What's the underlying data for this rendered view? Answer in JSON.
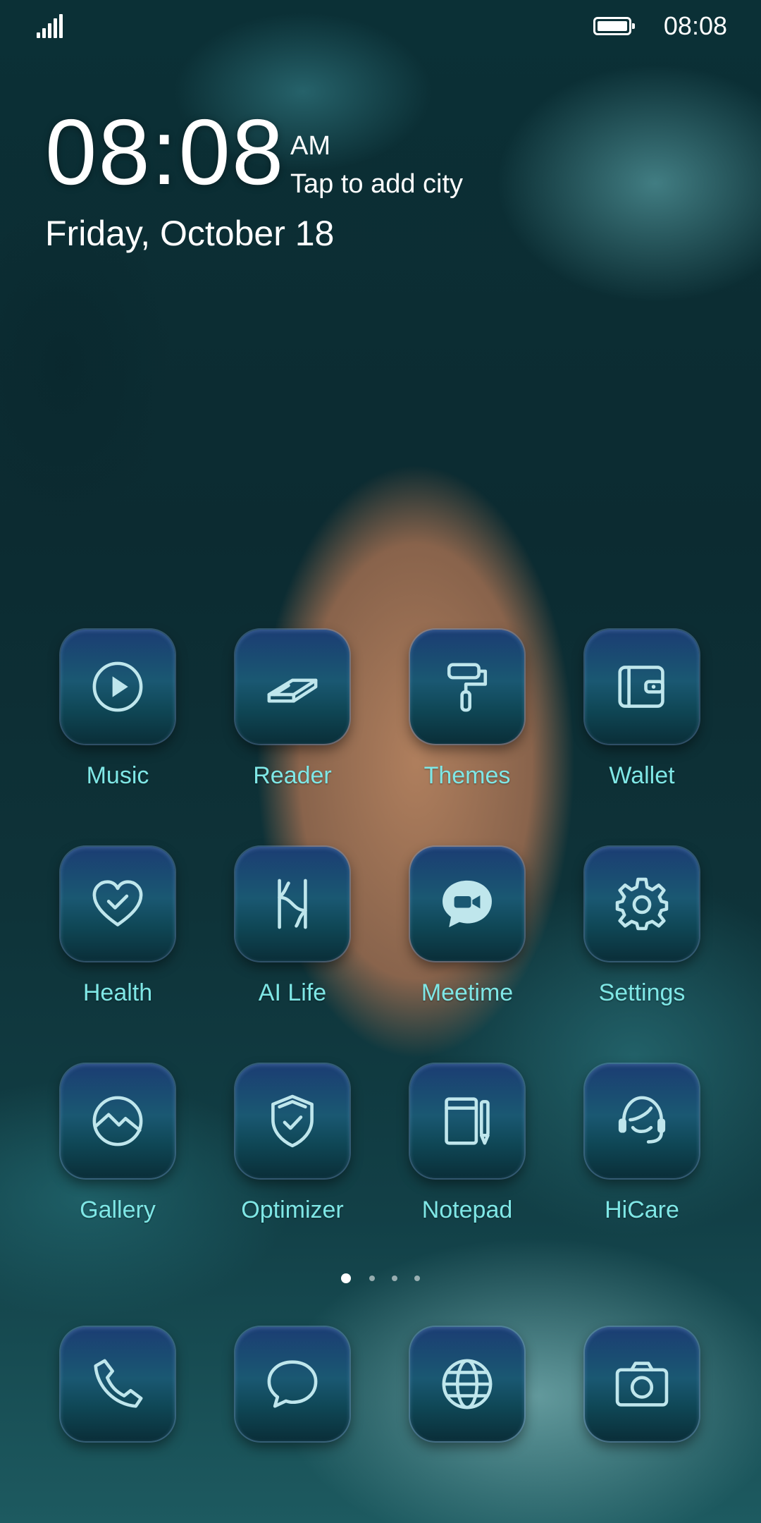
{
  "status_bar": {
    "time": "08:08"
  },
  "lock": {
    "clock": "08:08",
    "ampm": "AM",
    "city_prompt": "Tap to add city",
    "date": "Friday, October 18"
  },
  "apps": [
    {
      "label": "Music",
      "icon": "play-circle-icon"
    },
    {
      "label": "Reader",
      "icon": "book-icon"
    },
    {
      "label": "Themes",
      "icon": "paint-roller-icon"
    },
    {
      "label": "Wallet",
      "icon": "wallet-icon"
    },
    {
      "label": "Health",
      "icon": "heart-check-icon"
    },
    {
      "label": "AI Life",
      "icon": "ai-life-icon"
    },
    {
      "label": "Meetime",
      "icon": "video-chat-icon"
    },
    {
      "label": "Settings",
      "icon": "gear-icon"
    },
    {
      "label": "Gallery",
      "icon": "gallery-icon"
    },
    {
      "label": "Optimizer",
      "icon": "shield-check-icon"
    },
    {
      "label": "Notepad",
      "icon": "notepad-icon"
    },
    {
      "label": "HiCare",
      "icon": "headset-icon"
    }
  ],
  "pager": {
    "pages": 4,
    "current": 1
  },
  "dock": [
    {
      "icon": "phone-icon"
    },
    {
      "icon": "message-icon"
    },
    {
      "icon": "browser-icon"
    },
    {
      "icon": "camera-icon"
    }
  ],
  "colors": {
    "label": "#7fe7e6",
    "icon_stroke": "#bfe6ec"
  }
}
